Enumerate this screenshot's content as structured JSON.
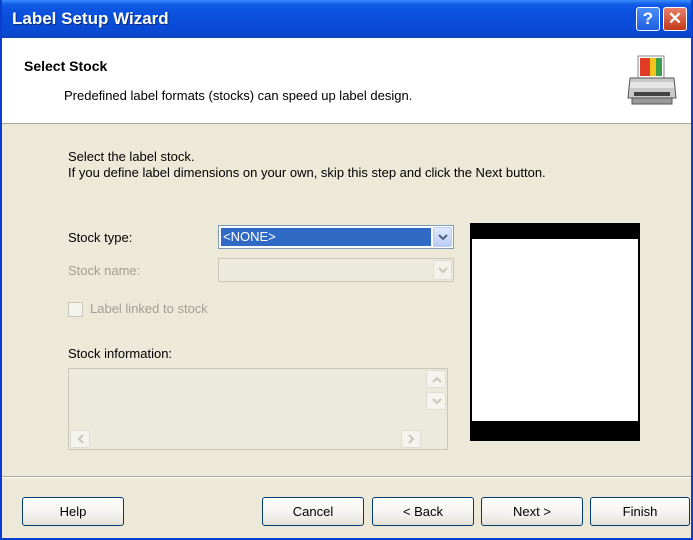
{
  "window": {
    "title": "Label Setup Wizard",
    "help_glyph": "?",
    "close_glyph": "✕"
  },
  "header": {
    "title": "Select Stock",
    "subtitle": "Predefined label formats (stocks) can speed up label design.",
    "icon": "printer-icon"
  },
  "instructions": {
    "line1": "Select the label stock.",
    "line2": "If you define label dimensions on your own, skip this step and click the Next button."
  },
  "form": {
    "stock_type_label": "Stock type:",
    "stock_type_value": "<NONE>",
    "stock_name_label": "Stock name:",
    "stock_name_value": "",
    "linked_label": "Label linked to stock",
    "linked_checked": false,
    "info_label": "Stock information:",
    "info_value": ""
  },
  "buttons": {
    "help": "Help",
    "cancel": "Cancel",
    "back": "< Back",
    "next": "Next >",
    "finish": "Finish"
  },
  "colors": {
    "title_bar": "#0a4ad4",
    "selection": "#316ac5",
    "dialog_bg": "#ece9d8"
  }
}
